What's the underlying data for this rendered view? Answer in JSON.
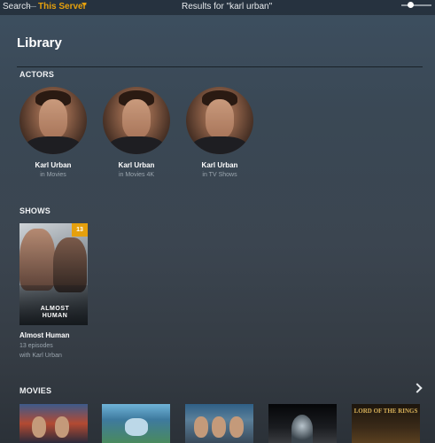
{
  "topbar": {
    "search_label": "Search",
    "separator": "—",
    "server_label": "This Server",
    "results_label": "Results for \"karl urban\"",
    "accent_color": "#e5a00d"
  },
  "library": {
    "title": "Library"
  },
  "actors": {
    "heading": "ACTORS",
    "items": [
      {
        "name": "Karl Urban",
        "subtitle": "in Movies"
      },
      {
        "name": "Karl Urban",
        "subtitle": "in Movies 4K"
      },
      {
        "name": "Karl Urban",
        "subtitle": "in TV Shows"
      }
    ]
  },
  "shows": {
    "heading": "SHOWS",
    "items": [
      {
        "title": "Almost Human",
        "poster_text": "ALMOST HUMAN",
        "badge": "13",
        "episodes": "13 episodes",
        "with": "with Karl Urban"
      }
    ]
  },
  "movies": {
    "heading": "MOVIES",
    "next_icon": "chevron-right-icon",
    "items": [
      {
        "poster_text": ""
      },
      {
        "poster_text": ""
      },
      {
        "poster_text": ""
      },
      {
        "poster_text": ""
      },
      {
        "poster_text": "LORD OF THE RINGS"
      }
    ]
  }
}
